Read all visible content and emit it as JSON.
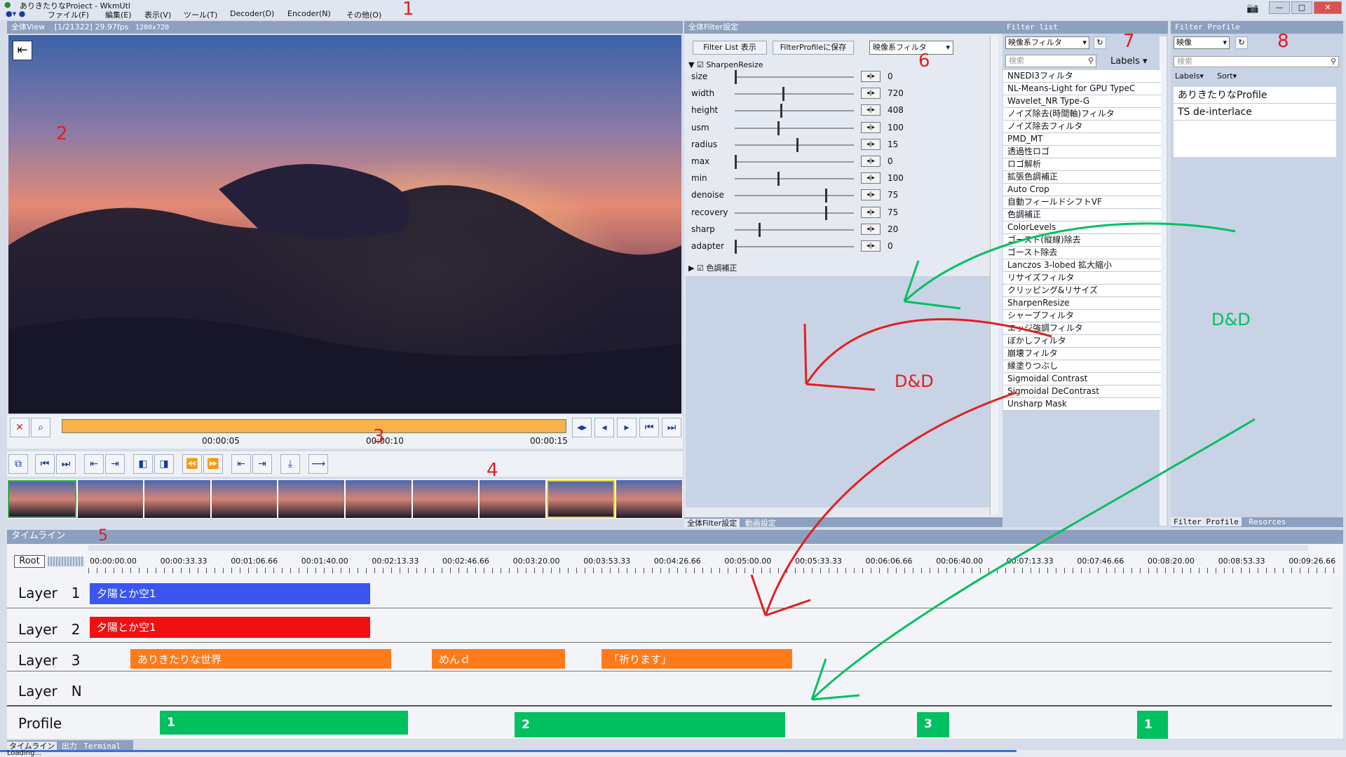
{
  "app": {
    "title": "ありきたりなProject - WkmUtl"
  },
  "menu": [
    "ファイル(F)",
    "編集(E)",
    "表示(V)",
    "ツール(T)",
    "Decoder(D)",
    "Encoder(N)",
    "その他(O)"
  ],
  "preview": {
    "title": "全体View",
    "info": "[1/21322] 29.97fps",
    "resolution": "1280x720",
    "times": [
      "00:00:05",
      "00:00:10",
      "00:00:15"
    ]
  },
  "filter_settings": {
    "title": "全体Filter設定",
    "btn_list": "Filter List 表示",
    "btn_save": "FilterProfileに保存",
    "category": "映像系フィルタ",
    "section1": "SharpenResize",
    "section2": "色調補正",
    "params": [
      {
        "name": "size",
        "value": "0",
        "pos": 0.0
      },
      {
        "name": "width",
        "value": "720",
        "pos": 0.4
      },
      {
        "name": "height",
        "value": "408",
        "pos": 0.38
      },
      {
        "name": "usm",
        "value": "100",
        "pos": 0.36
      },
      {
        "name": "radius",
        "value": "15",
        "pos": 0.52
      },
      {
        "name": "max",
        "value": "0",
        "pos": 0.0
      },
      {
        "name": "min",
        "value": "100",
        "pos": 0.36
      },
      {
        "name": "denoise",
        "value": "75",
        "pos": 0.76
      },
      {
        "name": "recovery",
        "value": "75",
        "pos": 0.76
      },
      {
        "name": "sharp",
        "value": "20",
        "pos": 0.2
      },
      {
        "name": "adapter",
        "value": "0",
        "pos": 0.0
      }
    ],
    "tabs": [
      "全体Filter設定",
      "動画設定"
    ]
  },
  "filter_list": {
    "title": "Filter list",
    "category": "映像系フィルタ",
    "search": "検索",
    "labels": "Labels",
    "items": [
      "NNEDI3フィルタ",
      "NL-Means-Light for GPU TypeC",
      "Wavelet_NR Type-G",
      "ノイズ除去(時間軸)フィルタ",
      "ノイズ除去フィルタ",
      "PMD_MT",
      "透過性ロゴ",
      "ロゴ解析",
      "拡張色調補正",
      "Auto Crop",
      "自動フィールドシフトVF",
      "色調補正",
      "ColorLevels",
      "ゴースト(縦線)除去",
      "ゴースト除去",
      "Lanczos 3-lobed 拡大縮小",
      "リサイズフィルタ",
      "クリッピング&リサイズ",
      "SharpenResize",
      "シャープフィルタ",
      "エッジ強調フィルタ",
      "ぼかしフィルタ",
      "崩壊フィルタ",
      "縁塗りつぶし",
      "Sigmoidal Contrast",
      "Sigmoidal DeContrast",
      "Unsharp Mask"
    ]
  },
  "filter_profile": {
    "title": "Filter Profile",
    "category": "映像",
    "search": "検索",
    "labels": "Labels",
    "sort": "Sort",
    "items": [
      "ありきたりなProfile",
      "TS de-interlace"
    ],
    "tabs": [
      "Filter Profile",
      "Resorces"
    ]
  },
  "timeline": {
    "title": "タイムライン",
    "root": "Root",
    "ticks": [
      "00:00:00.00",
      "00:00:33.33",
      "00:01:06.66",
      "00:01:40.00",
      "00:02:13.33",
      "00:02:46.66",
      "00:03:20.00",
      "00:03:53.33",
      "00:04:26.66",
      "00:05:00.00",
      "00:05:33.33",
      "00:06:06.66",
      "00:06:40.00",
      "00:07:13.33",
      "00:07:46.66",
      "00:08:20.00",
      "00:08:53.33",
      "00:09:26.66"
    ],
    "layers": [
      "Layer　1",
      "Layer　2",
      "Layer　3",
      "Layer　N",
      "Profile"
    ],
    "clips": {
      "l1": "夕陽とか空1",
      "l2": "夕陽とか空1",
      "l3a": "ありきたりな世界",
      "l3b": "めんｄ",
      "l3c": "「祈ります」",
      "p1": "1",
      "p2": "2",
      "p3": "3",
      "p4": "1"
    },
    "tabs": [
      "タイムライン",
      "出力",
      "Terminal"
    ]
  },
  "status": "Loading...",
  "annotations": {
    "n1": "1",
    "n2": "2",
    "n3": "3",
    "n4": "4",
    "n5": "5",
    "n6": "6",
    "n7": "7",
    "n8": "8",
    "dd_red": "D&D",
    "dd_green": "D&D"
  },
  "colors": {
    "blue": "#3a55f0",
    "red": "#f01010",
    "orange": "#ff7b1a",
    "green": "#00c060"
  }
}
